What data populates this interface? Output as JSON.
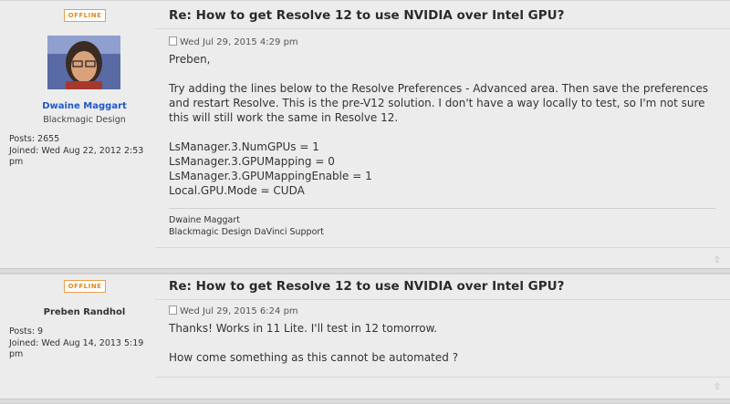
{
  "posts": [
    {
      "status": "OFFLINE",
      "title": "Re: How to get Resolve 12 to use NVIDIA over Intel GPU?",
      "author": "Dwaine Maggart",
      "rank": "Blackmagic Design",
      "posts_label": "Posts: 2655",
      "joined_label": "Joined: Wed Aug 22, 2012 2:53 pm",
      "date": "Wed Jul 29, 2015 4:29 pm",
      "body": [
        "Preben,",
        "",
        "Try adding the lines below to the Resolve Preferences - Advanced area. Then save the preferences and restart Resolve. This is the pre-V12 solution. I don't have a way locally to test, so I'm not sure this will still work the same in Resolve 12.",
        "",
        "LsManager.3.NumGPUs = 1",
        "LsManager.3.GPUMapping = 0",
        "LsManager.3.GPUMappingEnable = 1",
        "Local.GPU.Mode = CUDA"
      ],
      "signature": [
        "Dwaine Maggart",
        "Blackmagic Design DaVinci Support"
      ]
    },
    {
      "status": "OFFLINE",
      "title": "Re: How to get Resolve 12 to use NVIDIA over Intel GPU?",
      "author": "Preben Randhol",
      "posts_label": "Posts: 9",
      "joined_label": "Joined: Wed Aug 14, 2013 5:19 pm",
      "date": "Wed Jul 29, 2015 6:24 pm",
      "body": [
        "Thanks! Works in 11 Lite. I'll test in 12 tomorrow.",
        "",
        "How come something as this cannot be automated ?"
      ]
    }
  ],
  "colors": {
    "author_link": "#1e57c8",
    "offline": "#e08a1e"
  },
  "icons": {
    "post": "post-icon",
    "top": "back-to-top-icon"
  }
}
